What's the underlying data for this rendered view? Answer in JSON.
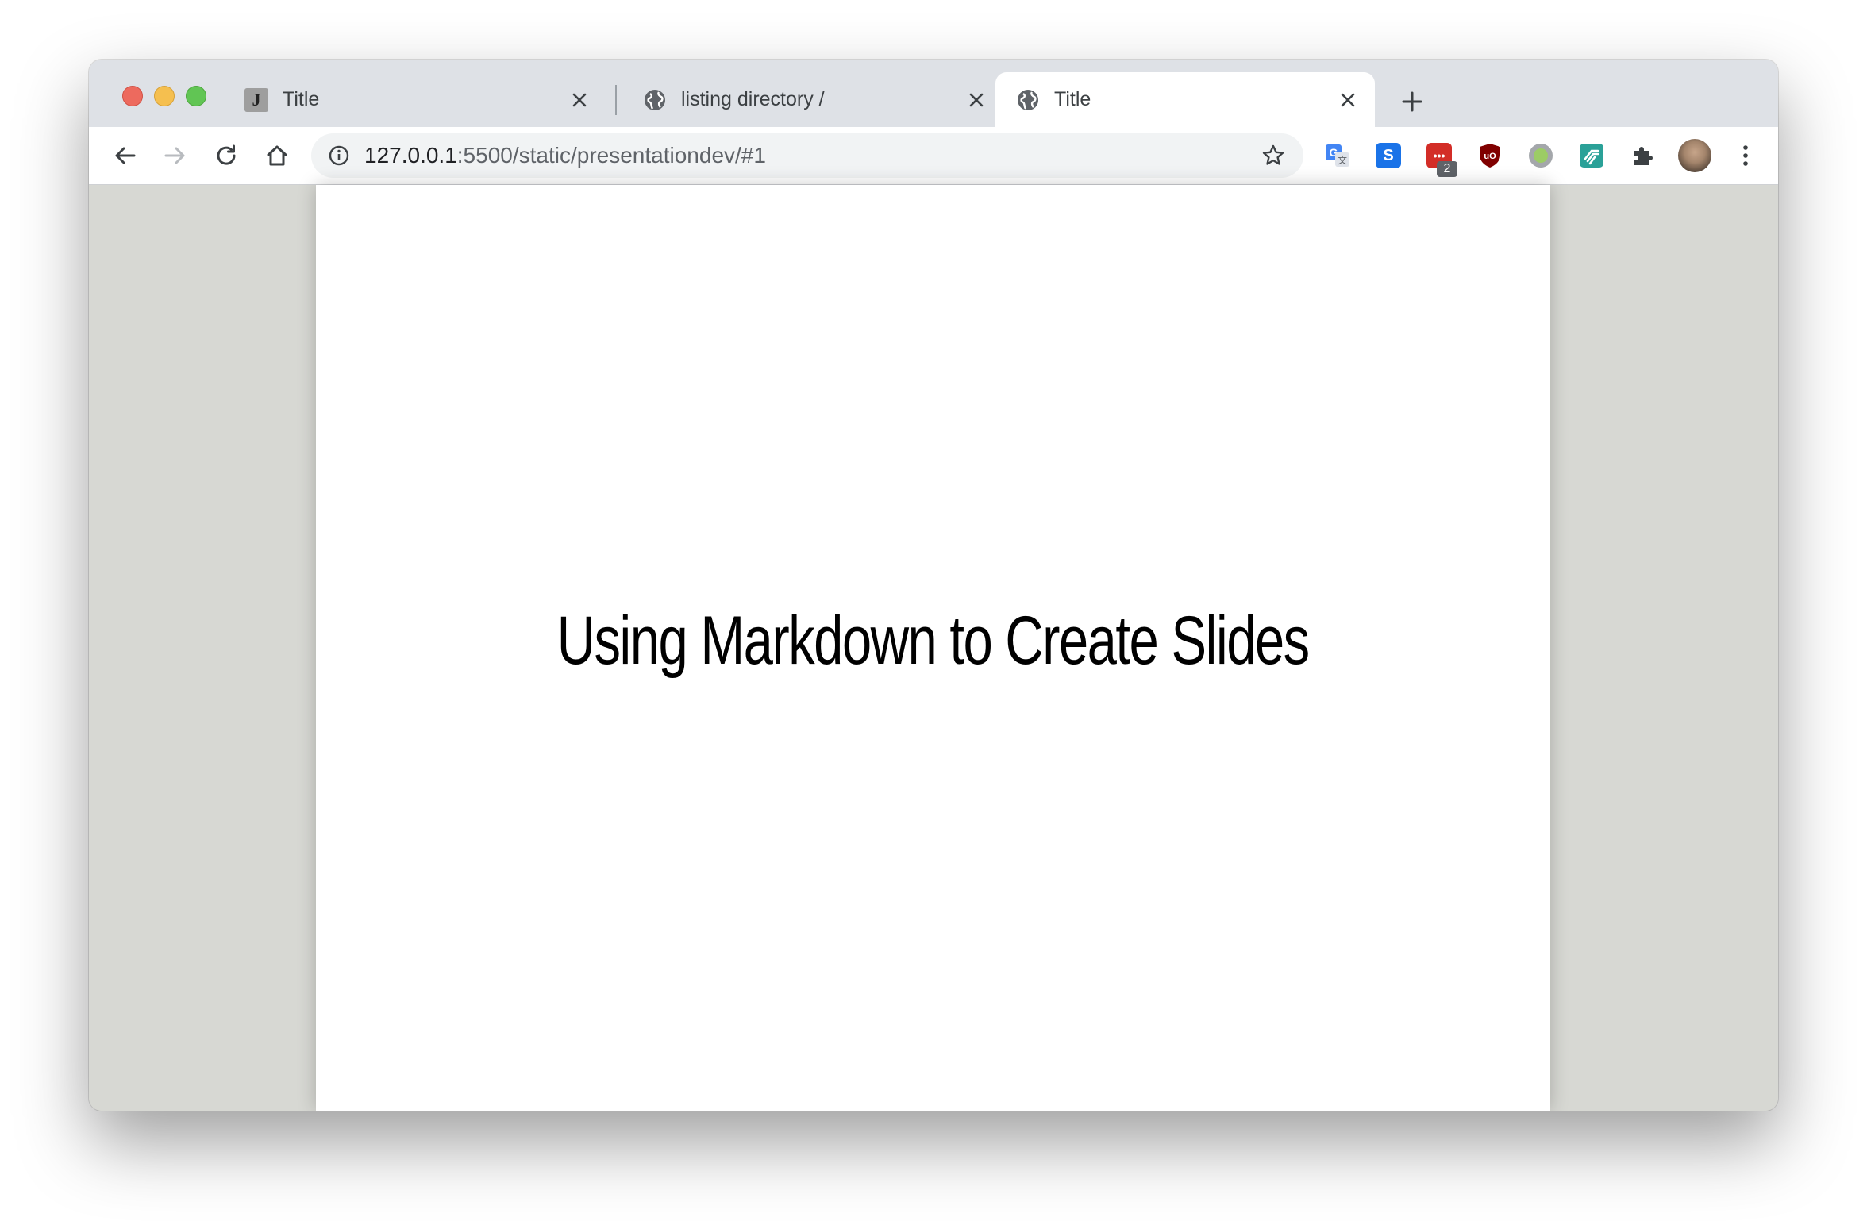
{
  "browser": {
    "tabs": [
      {
        "title": "Title",
        "favicon": "j-logo-icon",
        "active": false
      },
      {
        "title": "listing directory /",
        "favicon": "globe-icon",
        "active": false
      },
      {
        "title": "Title",
        "favicon": "globe-icon",
        "active": true
      }
    ],
    "address_bar": {
      "host": "127.0.0.1",
      "rest": ":5500/static/presentationdev/#1"
    },
    "extensions": [
      {
        "name": "google-translate-icon"
      },
      {
        "name": "s-extension-icon",
        "label": "S"
      },
      {
        "name": "lastpass-icon",
        "label": "•••",
        "badge": "2"
      },
      {
        "name": "ublock-origin-icon",
        "label": "uO"
      },
      {
        "name": "circle-extension-icon"
      },
      {
        "name": "feedly-like-icon"
      },
      {
        "name": "extensions-puzzle-icon"
      },
      {
        "name": "profile-avatar"
      },
      {
        "name": "menu-kebab-icon"
      }
    ]
  },
  "slide": {
    "title": "Using Markdown to Create Slides"
  },
  "colors": {
    "tabstrip": "#dee1e6",
    "page_background": "#d7d8d3",
    "slide_background": "#ffffff"
  }
}
